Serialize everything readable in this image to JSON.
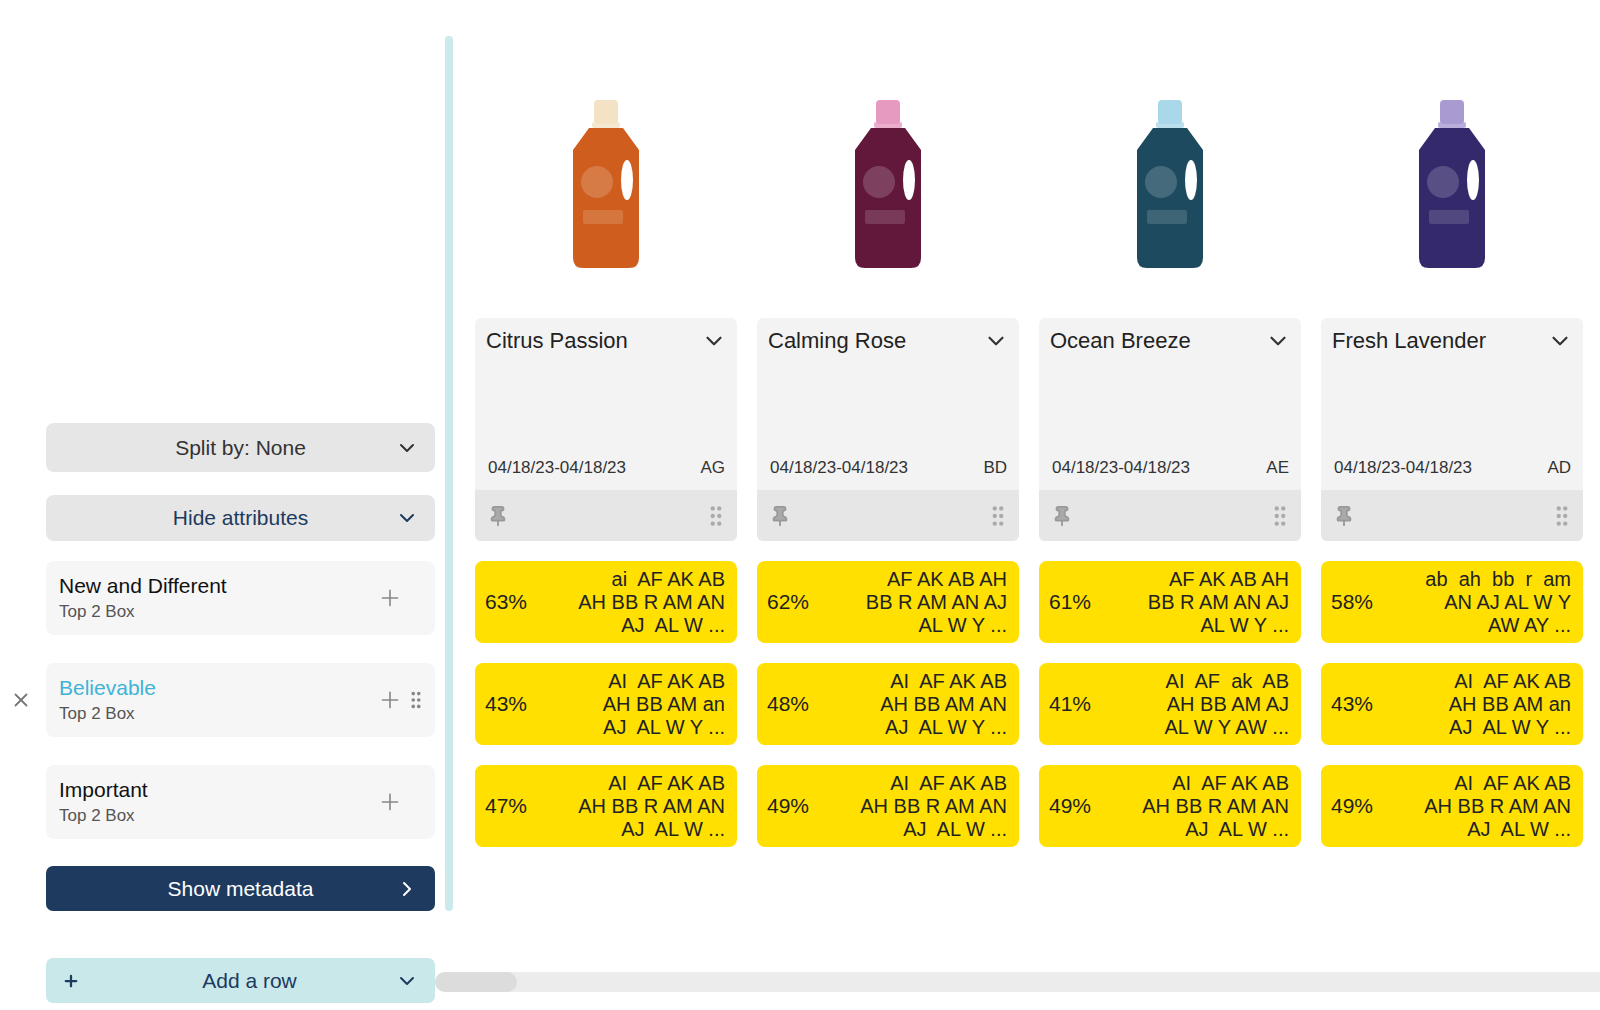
{
  "controls": {
    "split": "Split by: None",
    "hide": "Hide attributes",
    "metadata": "Show metadata",
    "addRow": "Add a row"
  },
  "products": [
    {
      "name": "Citrus Passion",
      "date": "04/18/23-04/18/23",
      "code": "AG",
      "color": "#cf5e1e",
      "capColor": "#f3e2c4"
    },
    {
      "name": "Calming Rose",
      "date": "04/18/23-04/18/23",
      "code": "BD",
      "color": "#62183a",
      "capColor": "#e79ac0"
    },
    {
      "name": "Ocean Breeze",
      "date": "04/18/23-04/18/23",
      "code": "AE",
      "color": "#1d4a5e",
      "capColor": "#a9d8ea"
    },
    {
      "name": "Fresh Lavender",
      "date": "04/18/23-04/18/23",
      "code": "AD",
      "color": "#34296a",
      "capColor": "#a99bd2"
    }
  ],
  "rows": [
    {
      "name": "New and Different",
      "metric": "Top 2 Box",
      "hovered": false,
      "cells": [
        {
          "value": "63%",
          "codes": [
            "ai  AF AK AB",
            "AH BB R AM AN",
            "AJ  AL W ..."
          ]
        },
        {
          "value": "62%",
          "codes": [
            "AF AK AB AH",
            "BB R AM AN AJ",
            "AL W Y ..."
          ]
        },
        {
          "value": "61%",
          "codes": [
            "AF AK AB AH",
            "BB R AM AN AJ",
            "AL W Y ..."
          ]
        },
        {
          "value": "58%",
          "codes": [
            "ab  ah  bb  r  am",
            "AN AJ AL W Y",
            "AW AY ..."
          ]
        }
      ]
    },
    {
      "name": "Believable",
      "metric": "Top 2 Box",
      "hovered": true,
      "cells": [
        {
          "value": "43%",
          "codes": [
            "AI  AF AK AB",
            "AH BB AM an",
            "AJ  AL W Y ..."
          ]
        },
        {
          "value": "48%",
          "codes": [
            "AI  AF AK AB",
            "AH BB AM AN",
            "AJ  AL W Y ..."
          ]
        },
        {
          "value": "41%",
          "codes": [
            "AI  AF  ak  AB",
            "AH BB AM AJ",
            "AL W Y AW ..."
          ]
        },
        {
          "value": "43%",
          "codes": [
            "AI  AF AK AB",
            "AH BB AM an",
            "AJ  AL W Y ..."
          ]
        }
      ]
    },
    {
      "name": "Important",
      "metric": "Top 2 Box",
      "hovered": false,
      "cells": [
        {
          "value": "47%",
          "codes": [
            "AI  AF AK AB",
            "AH BB R AM AN",
            "AJ  AL W ..."
          ]
        },
        {
          "value": "49%",
          "codes": [
            "AI  AF AK AB",
            "AH BB R AM AN",
            "AJ  AL W ..."
          ]
        },
        {
          "value": "49%",
          "codes": [
            "AI  AF AK AB",
            "AH BB R AM AN",
            "AJ  AL W ..."
          ]
        },
        {
          "value": "49%",
          "codes": [
            "AI  AF AK AB",
            "AH BB R AM AN",
            "AJ  AL W ..."
          ]
        }
      ]
    }
  ]
}
